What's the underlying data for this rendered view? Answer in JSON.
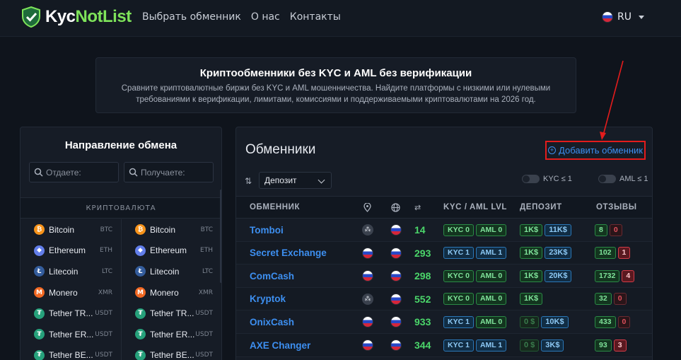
{
  "brand": {
    "part1": "Kyc",
    "part2": "NotList"
  },
  "nav": [
    "Выбрать обменник",
    "О нас",
    "Контакты"
  ],
  "language": "RU",
  "hero": {
    "title": "Криптообменники без KYC и AML без верификации",
    "subtitle": "Сравните криптовалютные биржи без KYC и AML мошенничества. Найдите платформы с низкими или нулевыми требованиями к верификации, лимитами, комиссиями и поддерживаемыми криптовалютами на 2026 год."
  },
  "direction": {
    "title": "Направление обмена",
    "give_placeholder": "Отдаете:",
    "get_placeholder": "Получаете:",
    "section": "КРИПТОВАЛЮТА",
    "coins": [
      {
        "name": "Bitcoin",
        "ticker": "BTC",
        "color": "#f7931a",
        "glyph": "₿"
      },
      {
        "name": "Ethereum",
        "ticker": "ETH",
        "color": "#627eea",
        "glyph": "◆"
      },
      {
        "name": "Litecoin",
        "ticker": "LTC",
        "color": "#345d9d",
        "glyph": "Ł"
      },
      {
        "name": "Monero",
        "ticker": "XMR",
        "color": "#f26822",
        "glyph": "M"
      },
      {
        "name": "Tether TR...",
        "ticker": "USDT",
        "color": "#26a17b",
        "glyph": "₮"
      },
      {
        "name": "Tether ER...",
        "ticker": "USDT",
        "color": "#26a17b",
        "glyph": "₮"
      },
      {
        "name": "Tether BE...",
        "ticker": "USDT",
        "color": "#26a17b",
        "glyph": "₮"
      }
    ]
  },
  "exchangers": {
    "title": "Обменники",
    "add_label": "Добавить обменник",
    "sort_option": "Депозит",
    "toggle_kyc": "KYC ≤ 1",
    "toggle_aml": "AML ≤ 1",
    "columns": {
      "name": "ОБМЕННИК",
      "kyc": "KYC / AML LVL",
      "deposit": "ДЕПОЗИТ",
      "reviews": "ОТЗЫВЫ"
    },
    "rows": [
      {
        "name": "Tomboi",
        "loc": "tor",
        "count": "14",
        "kyc": "KYC 0",
        "aml": "AML 0",
        "level": "green",
        "dep1": "1K$",
        "dep1_dim": false,
        "dep2": "11K$",
        "pos": "8",
        "neg": "0",
        "neg_hot": false
      },
      {
        "name": "Secret Exchange",
        "loc": "ru",
        "count": "293",
        "kyc": "KYC 1",
        "aml": "AML 1",
        "level": "blue",
        "dep1": "1K$",
        "dep1_dim": false,
        "dep2": "23K$",
        "pos": "102",
        "neg": "1",
        "neg_hot": true
      },
      {
        "name": "ComCash",
        "loc": "ru",
        "count": "298",
        "kyc": "KYC 0",
        "aml": "AML 0",
        "level": "green",
        "dep1": "1K$",
        "dep1_dim": false,
        "dep2": "20K$",
        "pos": "1732",
        "neg": "4",
        "neg_hot": true
      },
      {
        "name": "Kryptok",
        "loc": "tor",
        "count": "552",
        "kyc": "KYC 0",
        "aml": "AML 0",
        "level": "green",
        "dep1": "1K$",
        "dep1_dim": false,
        "dep2": "",
        "pos": "32",
        "neg": "0",
        "neg_hot": false
      },
      {
        "name": "OnixCash",
        "loc": "ru",
        "count": "933",
        "kyc": "KYC 1",
        "aml": "AML 0",
        "level": "mixed",
        "dep1": "0 $",
        "dep1_dim": true,
        "dep2": "10K$",
        "pos": "433",
        "neg": "0",
        "neg_hot": false
      },
      {
        "name": "AXE Changer",
        "loc": "ru",
        "count": "344",
        "kyc": "KYC 1",
        "aml": "AML 1",
        "level": "blue",
        "dep1": "0 $",
        "dep1_dim": true,
        "dep2": "3K$",
        "pos": "93",
        "neg": "3",
        "neg_hot": true
      }
    ]
  }
}
